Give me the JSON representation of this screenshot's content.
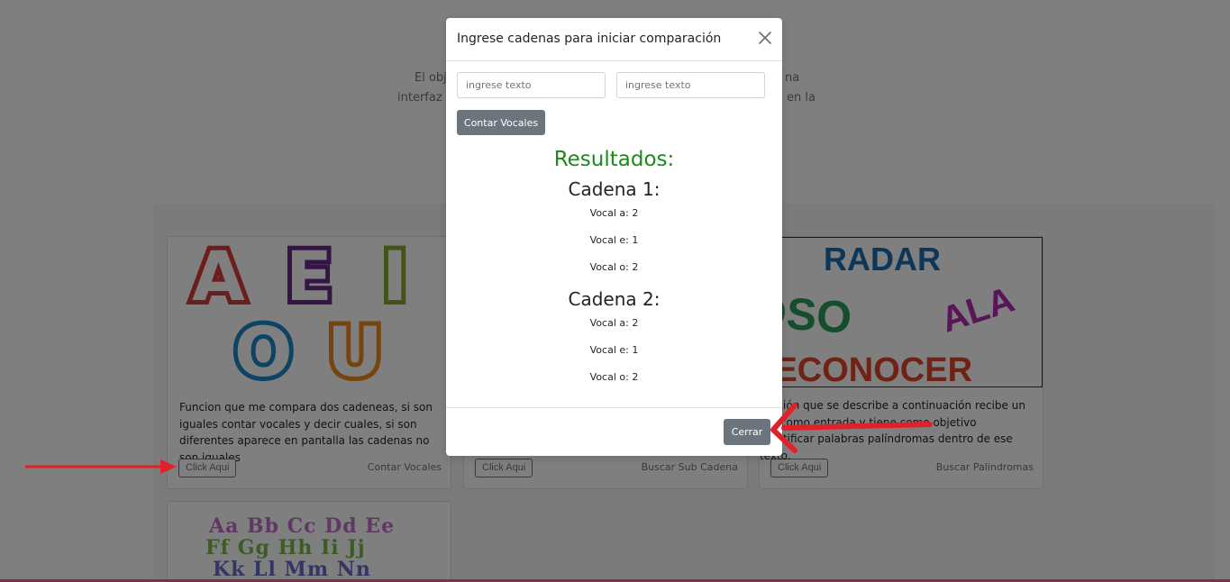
{
  "intro": {
    "line1_left": "El obj",
    "line1_right": "na",
    "line2_left": "interfaz a",
    "line2_right": "en la"
  },
  "cards": [
    {
      "image": "vowels-aeiou-image",
      "image_letters": [
        "A",
        "E",
        "I",
        "O",
        "U"
      ],
      "description": "Funcion que me compara dos cadeneas, si son iguales contar vocales y decir cuales, si son diferentes aparece en pantalla las cadenas no son iguales",
      "button": "Click Aqui",
      "meta": "Contar Vocales"
    },
    {
      "image": "hidden-image",
      "description": "",
      "button": "Click Aqui",
      "meta": "Buscar Sub Cadena"
    },
    {
      "image": "palindromes-image",
      "image_words": [
        "RADAR",
        "OSO",
        "ALA",
        "RECONOCER"
      ],
      "description": "La función que se describe a continuación recibe un texto como entrada y tiene como objetivo identificar las palabras palíndromas dentro de ese texto.",
      "desc_visible": "función que se describe a continuación recibe un xto como entrada y tiene como objetivo identificar palabras palíndromas dentro de ese texto.",
      "button": "Click Aqui",
      "meta": "Buscar Palindromas"
    },
    {
      "image": "alphabet-image",
      "image_rows": [
        "Aa Bb Cc Dd Ee",
        "Ff Gg Hh Ii Jj",
        "Kk Ll Mm Nn"
      ]
    }
  ],
  "modal": {
    "title": "Ingrese cadenas para iniciar comparación",
    "input1_placeholder": "ingrese texto",
    "input2_placeholder": "ingrese texto",
    "count_button": "Contar Vocales",
    "results_title": "Resultados:",
    "cadena1_title": "Cadena 1:",
    "cadena1_vocales": [
      "Vocal a: 2",
      "Vocal e: 1",
      "Vocal o: 2"
    ],
    "cadena2_title": "Cadena 2:",
    "cadena2_vocales": [
      "Vocal a: 2",
      "Vocal e: 1",
      "Vocal o: 2"
    ],
    "close_button": "Cerrar"
  },
  "colors": {
    "results_green": "#1b8a1b",
    "arrow_red": "#e0202a",
    "button_gray": "#6c757d"
  }
}
